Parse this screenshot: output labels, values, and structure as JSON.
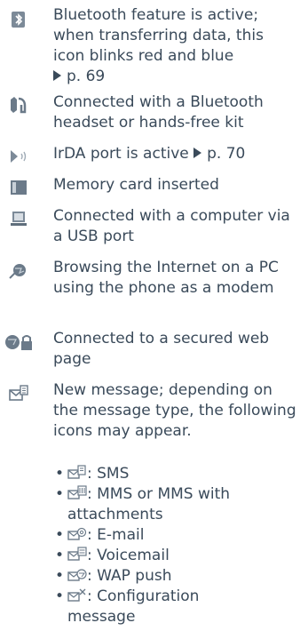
{
  "items": [
    {
      "icon": "bluetooth-icon",
      "text": "Bluetooth feature is active; when transferring data, this icon blinks red and blue",
      "ref": "p. 69"
    },
    {
      "icon": "bluetooth-headset-icon",
      "text": "Connected with a Bluetooth headset or hands-free kit"
    },
    {
      "icon": "irda-icon",
      "text": "IrDA port is active",
      "ref": "p. 70"
    },
    {
      "icon": "memory-card-icon",
      "text": "Memory card inserted"
    },
    {
      "icon": "computer-icon",
      "text": "Connected with a computer via a USB port"
    },
    {
      "icon": "modem-browse-icon",
      "text": "Browsing the Internet on a PC using the phone as a modem"
    },
    {
      "icon": "secured-web-icon",
      "text": "Connected to a secured web page"
    },
    {
      "icon": "new-message-icon",
      "text": "New message; depending on the message type, the following icons may appear."
    }
  ],
  "message_types": [
    {
      "icon": "sms-icon",
      "label": ": SMS"
    },
    {
      "icon": "mms-icon",
      "label": ": MMS or MMS with",
      "label2": "attachments"
    },
    {
      "icon": "email-icon",
      "label": ": E-mail"
    },
    {
      "icon": "voicemail-icon",
      "label": ": Voicemail"
    },
    {
      "icon": "wap-push-icon",
      "label": ": WAP push"
    },
    {
      "icon": "configuration-icon",
      "label": ": Configuration",
      "label2": "message"
    }
  ]
}
